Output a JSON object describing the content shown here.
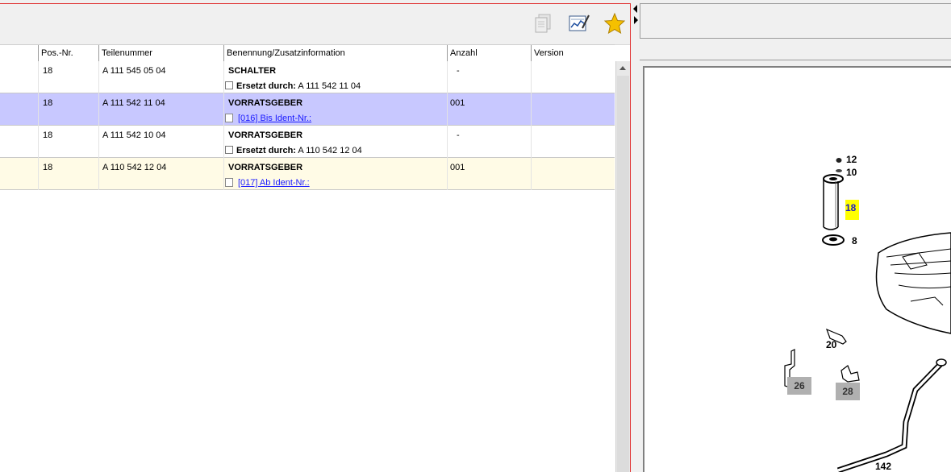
{
  "toolbar": {
    "icons": [
      "copy-icon",
      "chart-edit-icon",
      "star-icon"
    ],
    "star_color": "#f5c000"
  },
  "table": {
    "columns": [
      "Pos.-Nr.",
      "Teilenummer",
      "Benennung/Zusatzinformation",
      "Anzahl",
      "Version"
    ],
    "rows": [
      {
        "pos": "18",
        "part": "A 111 545 05 04",
        "name": "SCHALTER",
        "qty": "-",
        "version": "",
        "sub_label": "Ersetzt durch:",
        "sub_value": "A 111 542 11 04",
        "sub_link": "",
        "bg": "#ffffff"
      },
      {
        "pos": "18",
        "part": "A 111 542 11 04",
        "name": "VORRATSGEBER",
        "qty": "001",
        "version": "",
        "sub_label": "",
        "sub_value": "",
        "sub_link": "[016] Bis Ident-Nr.:",
        "bg": "#c8c8ff"
      },
      {
        "pos": "18",
        "part": "A 111 542 10 04",
        "name": "VORRATSGEBER",
        "qty": "-",
        "version": "",
        "sub_label": "Ersetzt durch:",
        "sub_value": "A 110 542 12 04",
        "sub_link": "",
        "bg": "#ffffff"
      },
      {
        "pos": "18",
        "part": "A 110 542 12 04",
        "name": "VORRATSGEBER",
        "qty": "001",
        "version": "",
        "sub_label": "",
        "sub_value": "",
        "sub_link": "[017] Ab Ident-Nr.:",
        "bg": "#fffbe6"
      }
    ]
  },
  "diagram": {
    "labels": [
      "12",
      "10",
      "18",
      "8",
      "20",
      "26",
      "28",
      "142"
    ]
  }
}
